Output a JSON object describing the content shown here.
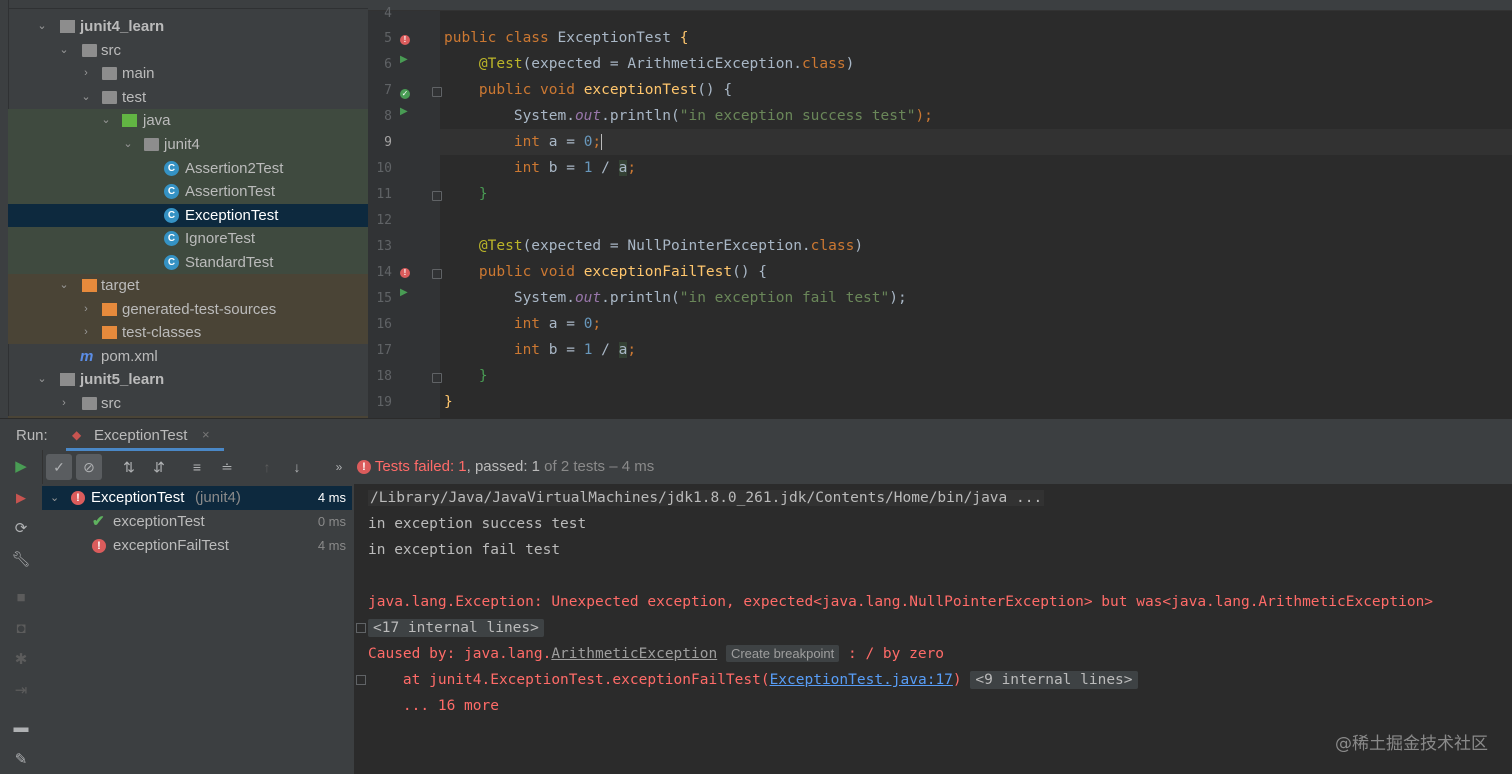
{
  "project_tree": {
    "items": [
      {
        "label": "junit4_learn",
        "bold": true
      },
      {
        "label": "src"
      },
      {
        "label": "main"
      },
      {
        "label": "test"
      },
      {
        "label": "java"
      },
      {
        "label": "junit4"
      },
      {
        "label": "Assertion2Test"
      },
      {
        "label": "AssertionTest"
      },
      {
        "label": "ExceptionTest"
      },
      {
        "label": "IgnoreTest"
      },
      {
        "label": "StandardTest"
      },
      {
        "label": "target"
      },
      {
        "label": "generated-test-sources"
      },
      {
        "label": "test-classes"
      },
      {
        "label": "pom.xml"
      },
      {
        "label": "junit5_learn",
        "bold": true
      },
      {
        "label": "src"
      }
    ],
    "maven_icon": "m",
    "class_icon": "C"
  },
  "editor": {
    "line_numbers": [
      "4",
      "5",
      "6",
      "7",
      "8",
      "9",
      "10",
      "11",
      "12",
      "13",
      "14",
      "15",
      "16",
      "17",
      "18",
      "19"
    ],
    "current_line": "9",
    "lines": [
      {
        "n": "4",
        "t": {}
      },
      {
        "n": "5",
        "t": {
          "kw1": "public class ",
          "name": "ExceptionTest ",
          "p": "{"
        }
      },
      {
        "n": "6",
        "t": {
          "ann": "@Test",
          "a": "(expected = ArithmeticException.",
          "kw": "class",
          "b": ")"
        }
      },
      {
        "n": "7",
        "t": {
          "kw1": "public void ",
          "fn": "exceptionTest",
          "p": "() {"
        }
      },
      {
        "n": "8",
        "t": {
          "a": "System.",
          "fld": "out",
          "b": ".println(",
          "str": "\"in exception success test\"",
          "c": ");"
        }
      },
      {
        "n": "9",
        "t": {
          "kw1": "int ",
          "a": "a = ",
          "num": "0",
          "c": ";"
        }
      },
      {
        "n": "10",
        "t": {
          "kw1": "int ",
          "a": "b = ",
          "num": "1",
          "b": " / ",
          "v": "a",
          "c": ";"
        }
      },
      {
        "n": "11",
        "t": {
          "p": "}"
        }
      },
      {
        "n": "12",
        "t": {}
      },
      {
        "n": "13",
        "t": {
          "ann": "@Test",
          "a": "(expected = NullPointerException.",
          "kw": "class",
          "b": ")"
        }
      },
      {
        "n": "14",
        "t": {
          "kw1": "public void ",
          "fn": "exceptionFailTest",
          "p": "() {"
        }
      },
      {
        "n": "15",
        "t": {
          "a": "System.",
          "fld": "out",
          "b": ".println(",
          "str": "\"in exception fail test\"",
          "c": ");"
        }
      },
      {
        "n": "16",
        "t": {
          "kw1": "int ",
          "a": "a = ",
          "num": "0",
          "c": ";"
        }
      },
      {
        "n": "17",
        "t": {
          "kw1": "int ",
          "a": "b = ",
          "num": "1",
          "b": " / ",
          "v": "a",
          "c": ";"
        }
      },
      {
        "n": "18",
        "t": {
          "p": "}"
        }
      },
      {
        "n": "19",
        "t": {
          "p": "}"
        }
      }
    ]
  },
  "run": {
    "label": "Run:",
    "tab": "ExceptionTest",
    "status_failed": "Tests failed: ",
    "status_failed_count": "1",
    "status_passed": ", passed: ",
    "status_passed_count": "1",
    "status_total": " of 2 tests – 4 ms",
    "tests": [
      {
        "name": "ExceptionTest",
        "suffix": " (junit4)",
        "time": "4 ms",
        "status": "failed"
      },
      {
        "name": "exceptionTest",
        "time": "0 ms",
        "status": "passed"
      },
      {
        "name": "exceptionFailTest",
        "time": "4 ms",
        "status": "failed"
      }
    ],
    "console": {
      "cmd": "/Library/Java/JavaVirtualMachines/jdk1.8.0_261.jdk/Contents/Home/bin/java ...",
      "out1": "in exception success test",
      "out2": "in exception fail test",
      "err1": "java.lang.Exception: Unexpected exception, expected<java.lang.NullPointerException> but was<java.lang.ArithmeticException>",
      "internal1": "<17 internal lines>",
      "caused_prefix": "Caused by: java.lang.",
      "caused_class": "ArithmeticException",
      "create_bp": "Create breakpoint",
      "caused_suffix": " : / by zero",
      "at_prefix": "    at junit4.ExceptionTest.exceptionFailTest(",
      "at_link": "ExceptionTest.java:17",
      "at_suffix": ")",
      "internal2": "<9 internal lines>",
      "more": "    ... 16 more"
    }
  },
  "watermark": "@稀土掘金技术社区",
  "colors": {
    "selection": "#0d293e",
    "test_bg": "#3f4a3f",
    "target_bg": "#4a4436",
    "error": "#ff6b68",
    "link": "#589df6"
  }
}
